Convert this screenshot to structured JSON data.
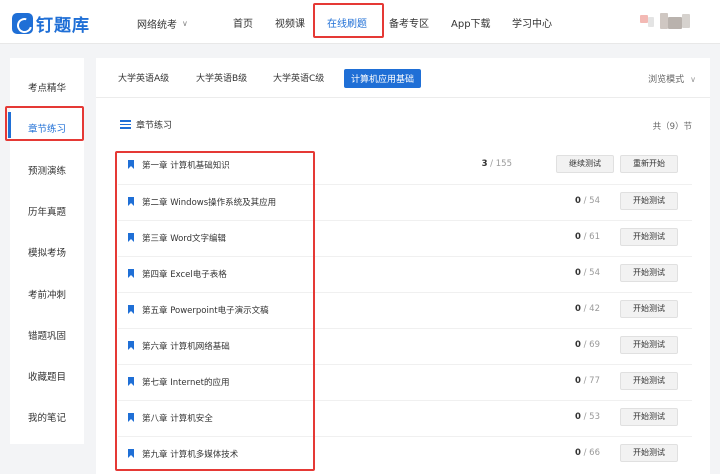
{
  "logo": {
    "text": "钉题库"
  },
  "header": {
    "exam_category": "网络统考",
    "nav": [
      "首页",
      "视频课",
      "在线刷题",
      "备考专区",
      "App下载",
      "学习中心"
    ],
    "active_nav": "在线刷题"
  },
  "sidebar": {
    "items": [
      "考点精华",
      "章节练习",
      "预测演练",
      "历年真题",
      "模拟考场",
      "考前冲刺",
      "错题巩固",
      "收藏题目",
      "我的笔记"
    ],
    "active": "章节练习"
  },
  "subject_tabs": {
    "items": [
      "大学英语A级",
      "大学英语B级",
      "大学英语C级",
      "计算机应用基础"
    ],
    "active": "计算机应用基础"
  },
  "browse_mode": "浏览模式",
  "section": {
    "title": "章节练习",
    "total_label": "共（9）节"
  },
  "chapters": [
    {
      "name": "第一章 计算机基础知识",
      "done": "3",
      "total": "155"
    },
    {
      "name": "第二章 Windows操作系统及其应用",
      "done": "0",
      "total": "54"
    },
    {
      "name": "第三章 Word文字编辑",
      "done": "0",
      "total": "61"
    },
    {
      "name": "第四章 Excel电子表格",
      "done": "0",
      "total": "54"
    },
    {
      "name": "第五章 Powerpoint电子演示文稿",
      "done": "0",
      "total": "42"
    },
    {
      "name": "第六章 计算机网络基础",
      "done": "0",
      "total": "69"
    },
    {
      "name": "第七章 Internet的应用",
      "done": "0",
      "total": "77"
    },
    {
      "name": "第八章 计算机安全",
      "done": "0",
      "total": "53"
    },
    {
      "name": "第九章 计算机多媒体技术",
      "done": "0",
      "total": "66"
    }
  ],
  "buttons": {
    "continue": "继续测试",
    "restart": "重新开始",
    "start": "开始测试"
  },
  "colors": {
    "accent": "#1f6fd6",
    "highlight": "#e53935"
  }
}
